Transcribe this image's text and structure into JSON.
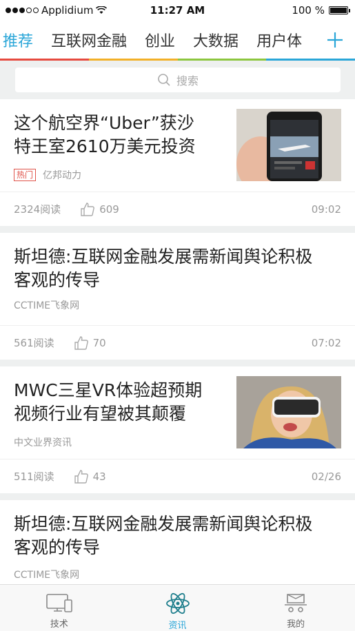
{
  "status_bar": {
    "carrier": "Applidium",
    "time": "11:27 AM",
    "battery": "100 %"
  },
  "tabs": [
    {
      "label": "推荐",
      "active": true
    },
    {
      "label": "互联网金融"
    },
    {
      "label": "创业"
    },
    {
      "label": "大数据"
    },
    {
      "label": "用户体"
    }
  ],
  "tab_colors": [
    "#e64a3f",
    "#f2b028",
    "#8cc63f",
    "#2aa6d8"
  ],
  "search": {
    "placeholder": "搜索"
  },
  "articles": [
    {
      "title_l1": "这个航空界“Uber”获沙",
      "title_l2": "特王室2610万美元投资",
      "badge": "热门",
      "source": "亿邦动力",
      "reads": "2324阅读",
      "likes": "609",
      "date": "09:02"
    },
    {
      "title_l1": "斯坦德:互联网金融发展需新闻舆论积极",
      "title_l2": "客观的传导",
      "source": "CCTIME飞象网",
      "reads": "561阅读",
      "likes": "70",
      "date": "07:02"
    },
    {
      "title_l1": "MWC三星VR体验超预期",
      "title_l2": "视频行业有望被其颠覆",
      "source": "中文业界资讯",
      "reads": "511阅读",
      "likes": "43",
      "date": "02/26"
    },
    {
      "title_l1": "斯坦德:互联网金融发展需新闻舆论积极",
      "title_l2": "客观的传导",
      "source": "CCTIME飞象网"
    }
  ],
  "bottom_nav": [
    {
      "label": "技术",
      "icon": "monitor-icon"
    },
    {
      "label": "资讯",
      "icon": "atom-icon",
      "active": true
    },
    {
      "label": "我的",
      "icon": "profile-icon"
    }
  ]
}
